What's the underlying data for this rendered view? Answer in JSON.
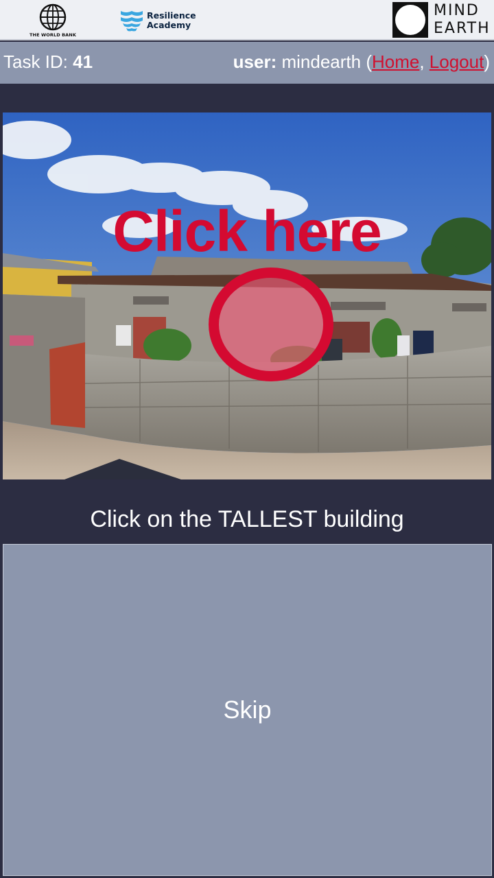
{
  "header": {
    "world_bank_label": "THE WORLD BANK",
    "resilience_line1": "Resilience",
    "resilience_line2": "Academy",
    "mindearth_line1": "MIND",
    "mindearth_line2": "EARTH"
  },
  "infobar": {
    "task_label": "Task ID: ",
    "task_id": "41",
    "user_label": "user:",
    "username": " mindearth (",
    "home_link": "Home",
    "separator": ", ",
    "logout_link": "Logout",
    "close_paren": ")"
  },
  "photo": {
    "overlay_text": "Click here"
  },
  "task": {
    "instruction": "Click on the TALLEST building",
    "skip_label": "Skip"
  },
  "colors": {
    "accent_red": "#d40a31",
    "panel": "#8c96ad",
    "background": "#2c2d42"
  }
}
